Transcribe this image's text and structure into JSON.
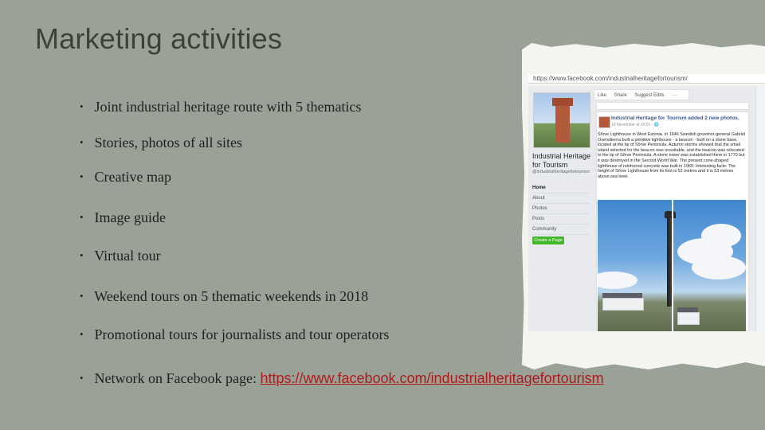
{
  "slide": {
    "title": "Marketing activities",
    "bullets": [
      "Joint industrial heritage route with 5 thematics",
      "Stories, photos of all sites",
      "Creative map",
      "Image guide",
      "Virtual tour",
      "Weekend tours on 5 thematic weekends in 2018",
      "Promotional tours for journalists and tour operators"
    ],
    "network": {
      "prefix": "Network on Facebook page: ",
      "link": "https://www.facebook.com/industrialheritagefortourism"
    },
    "bullet_char": "•"
  },
  "screenshot": {
    "url": "https://www.facebook.com/industrialheritagefortourism/",
    "toolbar": [
      "Like",
      "Share",
      "Suggest Edits",
      "···"
    ],
    "page_name": "Industrial Heritage for Tourism",
    "page_handle": "@industrialheritagefortourism",
    "nav": [
      "Home",
      "About",
      "Photos",
      "Posts",
      "Community"
    ],
    "create_page": "Create a Page",
    "post": {
      "author": "Industrial Heritage for Tourism added 2 new photos.",
      "date": "15 November at 20:01 · 🌐",
      "text": "Sõrve Lighthouse in West Estonia. In 1646 Swedish governor-general Gabriel Oxenstierna built a primitive lighthouse - a beacon - built on a stone base, located at the tip of Sõrve Peninsula. Autumn storms showed that the small island selected for the beacon was unsuitable, and the beacon was relocated to the tip of Sõrve Peninsula. A stone tower was established there in 1770 but it was destroyed in the Second World War. The present cone-shaped lighthouse of reinforced concrete was built in 1960. Interesting facts: The height of Sõrve Lighthouse from its foot is 52 metres and it is 53 metres above sea level."
    },
    "colors": {
      "fb_blue": "#385898",
      "fb_green": "#42b72a",
      "link_red": "#b01a1a"
    }
  }
}
